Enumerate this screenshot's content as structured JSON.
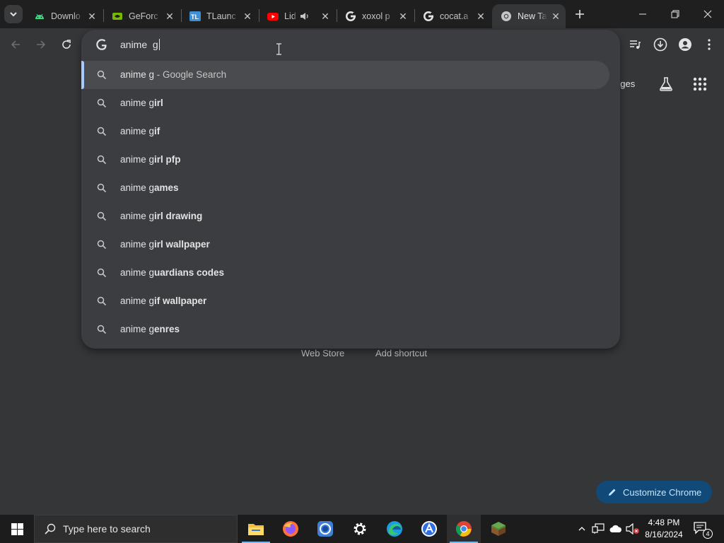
{
  "tabs": [
    {
      "title": "Downlo",
      "icon": "android-icon"
    },
    {
      "title": "GeForc",
      "icon": "nvidia-icon"
    },
    {
      "title": "TLaunc",
      "icon": "tlauncher-icon"
    },
    {
      "title": "Lid",
      "icon": "youtube-icon",
      "audio": true
    },
    {
      "title": "xoxol p",
      "icon": "google-icon"
    },
    {
      "title": "cocat.a",
      "icon": "google-icon"
    },
    {
      "title": "New Ta",
      "icon": "chrome-icon",
      "active": true
    }
  ],
  "omnibox": {
    "typed_text": "anime  g",
    "suggestions": [
      {
        "prefix": "anime g",
        "bold": "",
        "suffix": " - Google Search",
        "selected": true
      },
      {
        "prefix": "anime g",
        "bold": "irl",
        "suffix": ""
      },
      {
        "prefix": "anime g",
        "bold": "if",
        "suffix": ""
      },
      {
        "prefix": "anime g",
        "bold": "irl pfp",
        "suffix": ""
      },
      {
        "prefix": "anime g",
        "bold": "ames",
        "suffix": ""
      },
      {
        "prefix": "anime g",
        "bold": "irl drawing",
        "suffix": ""
      },
      {
        "prefix": "anime g",
        "bold": "irl wallpaper",
        "suffix": ""
      },
      {
        "prefix": "anime g",
        "bold": "uardians codes",
        "suffix": ""
      },
      {
        "prefix": "anime g",
        "bold": "if wallpaper",
        "suffix": ""
      },
      {
        "prefix": "anime g",
        "bold": "enres",
        "suffix": ""
      }
    ]
  },
  "ntp": {
    "images_link": "ages",
    "webstore_label": "Web Store",
    "add_shortcut_label": "Add shortcut",
    "customize_label": "Customize Chrome"
  },
  "taskbar": {
    "search_placeholder": "Type here to search",
    "time": "4:48 PM",
    "date": "8/16/2024",
    "notification_count": "4"
  },
  "colors": {
    "accent": "#a8c7fa",
    "customize_bg": "#114a79"
  }
}
